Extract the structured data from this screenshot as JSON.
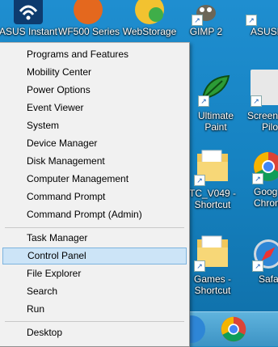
{
  "desktop_icons": [
    {
      "label": "ASUS Instant",
      "name": "asus-instant-icon"
    },
    {
      "label": "WF500 Series",
      "name": "wf500-series-icon"
    },
    {
      "label": "WebStorage",
      "name": "webstorage-icon"
    },
    {
      "label": "GIMP 2",
      "name": "gimp-icon"
    },
    {
      "label": "ASUSD",
      "name": "asusd-icon"
    },
    {
      "label": "Ultimate Paint",
      "line1": "Ultimate",
      "line2": "Paint",
      "name": "ultimate-paint-icon"
    },
    {
      "label": "Screens Pilo",
      "line1": "Screens",
      "line2": "Pilo",
      "name": "screenshot-pilot-icon"
    },
    {
      "label": "TC_V049 - Shortcut",
      "line1": "TC_V049 -",
      "line2": "Shortcut",
      "name": "folder-shortcut-icon"
    },
    {
      "label": "Goog Chrom",
      "line1": "Goog",
      "line2": "Chrom",
      "name": "chrome-icon"
    },
    {
      "label": "Games - Shortcut",
      "line1": "Games -",
      "line2": "Shortcut",
      "name": "games-folder-icon"
    },
    {
      "label": "Safa",
      "name": "safari-icon"
    }
  ],
  "menu": {
    "items": [
      {
        "label": "Programs and Features"
      },
      {
        "label": "Mobility Center"
      },
      {
        "label": "Power Options"
      },
      {
        "label": "Event Viewer"
      },
      {
        "label": "System"
      },
      {
        "label": "Device Manager"
      },
      {
        "label": "Disk Management"
      },
      {
        "label": "Computer Management"
      },
      {
        "label": "Command Prompt"
      },
      {
        "label": "Command Prompt (Admin)"
      },
      {
        "label": "Task Manager"
      },
      {
        "label": "Control Panel",
        "selected": true
      },
      {
        "label": "File Explorer"
      },
      {
        "label": "Search"
      },
      {
        "label": "Run"
      },
      {
        "label": "Desktop"
      }
    ]
  },
  "taskbar": {
    "icons": [
      "safari-icon",
      "chrome-icon"
    ]
  },
  "colors": {
    "desktop_bg": "#1683c2",
    "menu_bg": "#f1f1f1",
    "selection": "#cce4f7",
    "taskbar": "#3d93c4"
  }
}
